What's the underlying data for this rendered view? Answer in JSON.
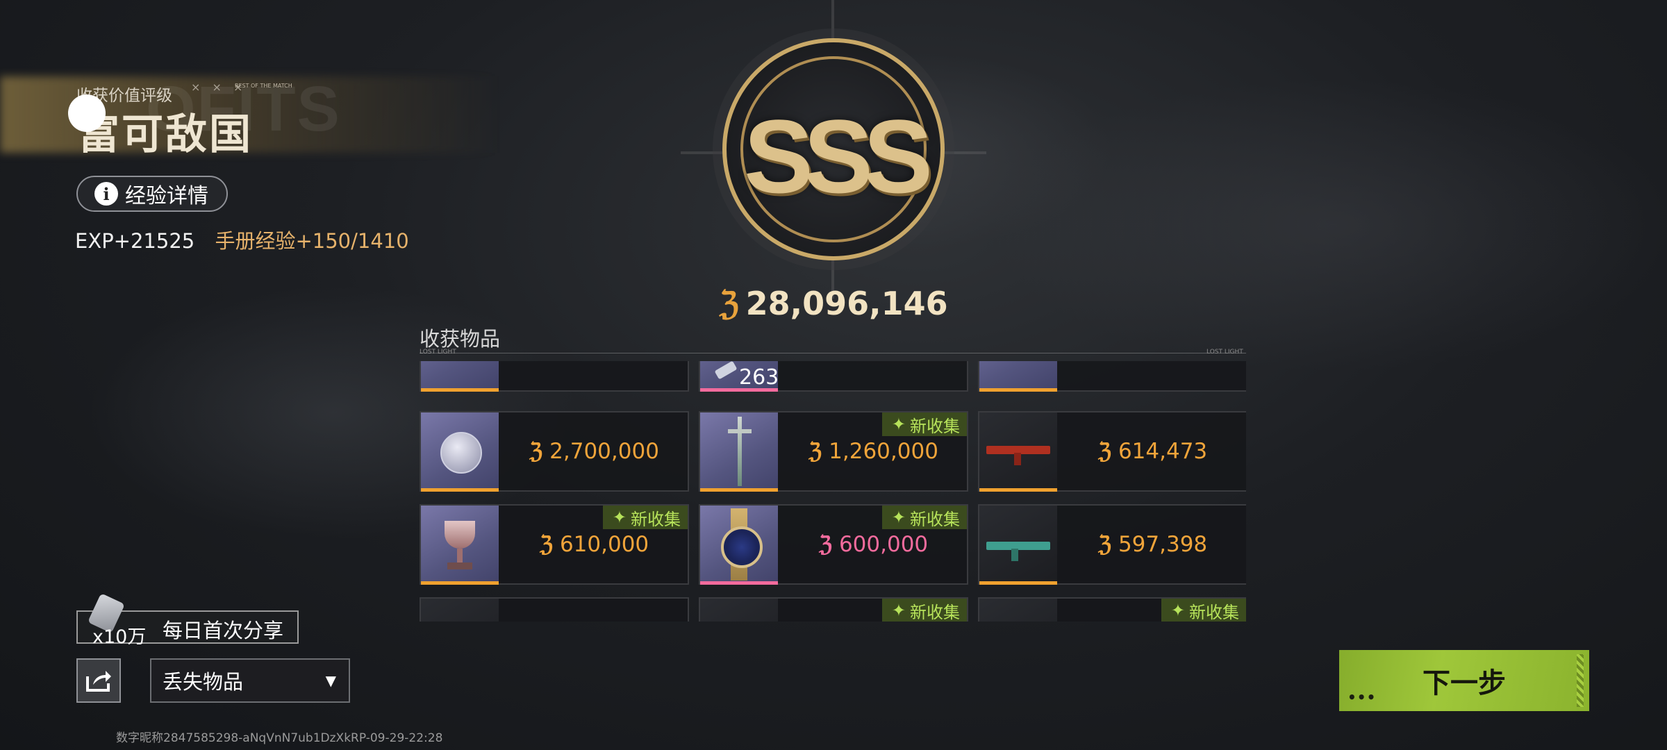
{
  "header": {
    "rating_label": "收获价值评级",
    "rating_marks": "× × ×",
    "rating_sub": "BEST OF THE MATCH",
    "rating_title": "富可敌国",
    "exp_details_label": "经验详情",
    "exp_value": "EXP+21525",
    "manual_exp": "手册经验+150/1410"
  },
  "grade": {
    "letters": "SSS",
    "total_value": "28,096,146"
  },
  "loot": {
    "title": "收获物品",
    "lost_left": "LOST LIGHT",
    "lost_right": "LOST LIGHT",
    "new_tag": "新收集",
    "top_row_qty": "263",
    "items": [
      {
        "price": "2,700,000",
        "color": "gold",
        "new": false
      },
      {
        "price": "1,260,000",
        "color": "gold",
        "new": true
      },
      {
        "price": "614,473",
        "color": "gold",
        "new": false
      },
      {
        "price": "610,000",
        "color": "gold",
        "new": true
      },
      {
        "price": "600,000",
        "color": "pink",
        "new": true
      },
      {
        "price": "597,398",
        "color": "gold",
        "new": false
      }
    ]
  },
  "share": {
    "reward_qty": "x10万",
    "label": "每日首次分享"
  },
  "dropdown": {
    "selected": "丢失物品"
  },
  "footer": {
    "user_id": "数字昵称2847585298-aNqVnN7ub1DzXkRP-09-29-22:28"
  },
  "next_button": {
    "label": "下一步"
  },
  "colors": {
    "accent_green": "#9fc73a",
    "gold": "#f0a43a",
    "pink": "#f26b9d",
    "tag_green": "#b6e25a"
  }
}
